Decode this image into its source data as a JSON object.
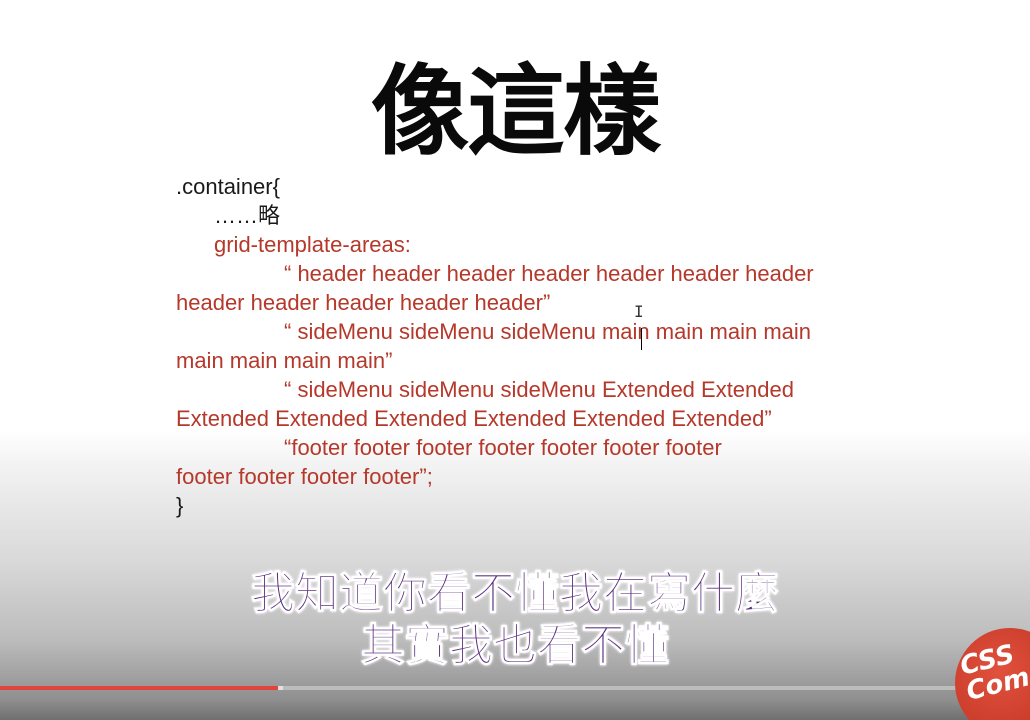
{
  "slide": {
    "title": "像這樣",
    "code_lines": [
      {
        "text": ".container{",
        "indent": 0,
        "color": "black"
      },
      {
        "text": "……略",
        "indent": 1,
        "color": "black"
      },
      {
        "text": "grid-template-areas:",
        "indent": 1,
        "color": "red"
      },
      {
        "text": "“ header header header header header header header",
        "indent": 2,
        "color": "red"
      },
      {
        "text": "header header header header header”",
        "indent": 0,
        "color": "red"
      },
      {
        "text": "“  sideMenu  sideMenu  sideMenu main main main main",
        "indent": 2,
        "color": "red"
      },
      {
        "text": "main main main main”",
        "indent": 0,
        "color": "red"
      },
      {
        "text": "“ sideMenu  sideMenu  sideMenu Extended Extended",
        "indent": 2,
        "color": "red"
      },
      {
        "text": "Extended Extended Extended Extended Extended Extended”",
        "indent": 0,
        "color": "red"
      },
      {
        "text": "“footer footer footer footer footer footer footer",
        "indent": 2,
        "color": "red"
      },
      {
        "text": "footer footer footer footer”;",
        "indent": 0,
        "color": "red"
      },
      {
        "text": "}",
        "indent": 0,
        "color": "black"
      }
    ]
  },
  "subtitles": {
    "line1": "我知道你看不懂我在寫什麼",
    "line2": "其實我也看不懂"
  },
  "cursor_glyph": "I",
  "player": {
    "played_fraction": 0.27,
    "buffered_fraction": 0.275
  },
  "logo": {
    "text": "CSS\nCom"
  },
  "colors": {
    "code_red": "#b5382a",
    "subtitle_purple": "#5b2d7f",
    "progress_red": "#e0443a",
    "logo_red": "#c93a2a"
  }
}
